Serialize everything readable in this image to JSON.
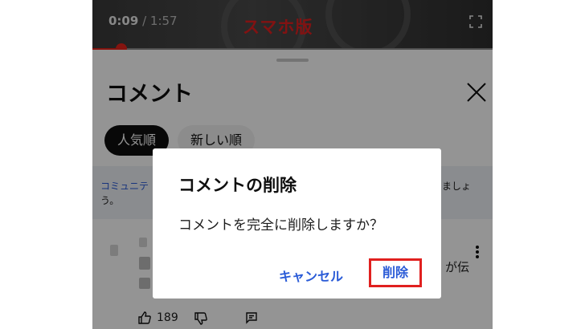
{
  "player": {
    "current_time": "0:09",
    "total_time": " / 1:57",
    "overlay_label": "スマホ版",
    "progress_fraction": 0.077
  },
  "comments_sheet": {
    "title": "コメント",
    "chips": {
      "popular": "人気順",
      "newest": "新しい順"
    },
    "notice": {
      "link_text": "コミュニテ",
      "tail_text": "ましょ",
      "line2": "う。"
    },
    "comment": {
      "text_tail": "が伝",
      "like_count": "189"
    }
  },
  "dialog": {
    "title": "コメントの削除",
    "message": "コメントを完全に削除しますか？",
    "cancel_label": "キャンセル",
    "delete_label": "削除"
  },
  "colors": {
    "accent_blue": "#2a5bd7",
    "highlight_red": "#e0201f",
    "progress_red": "#e6231a"
  },
  "icons": [
    "fullscreen-icon",
    "close-icon",
    "more-vert-icon",
    "thumb-up-icon",
    "thumb-down-icon",
    "reply-icon"
  ]
}
